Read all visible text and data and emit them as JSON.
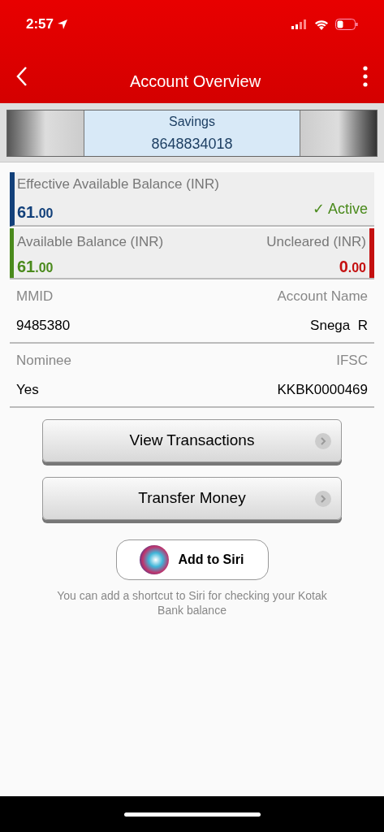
{
  "status_bar": {
    "time": "2:57"
  },
  "header": {
    "title": "Account Overview"
  },
  "account_selector": {
    "type": "Savings",
    "number": "8648834018"
  },
  "effective_balance": {
    "label": "Effective Available Balance (INR)",
    "amount": "61",
    "decimals": ".00",
    "status": "✓ Active"
  },
  "balances": [
    {
      "label": "Available Balance (INR)",
      "amount": "61",
      "decimals": ".00",
      "color": "#4a8a1c"
    },
    {
      "label": "Uncleared (INR)",
      "amount": "0",
      "decimals": ".00",
      "color": "#c41010"
    }
  ],
  "details": [
    {
      "left_label": "MMID",
      "left_value": "9485380",
      "right_label": "Account Name",
      "right_value": "Snega  R"
    },
    {
      "left_label": "Nominee",
      "left_value": "Yes",
      "right_label": "IFSC",
      "right_value": "KKBK0000469"
    }
  ],
  "actions": [
    "View Transactions",
    "Transfer Money"
  ],
  "siri": {
    "button": "Add to Siri",
    "note": "You can add a shortcut to Siri for checking your Kotak Bank balance"
  }
}
